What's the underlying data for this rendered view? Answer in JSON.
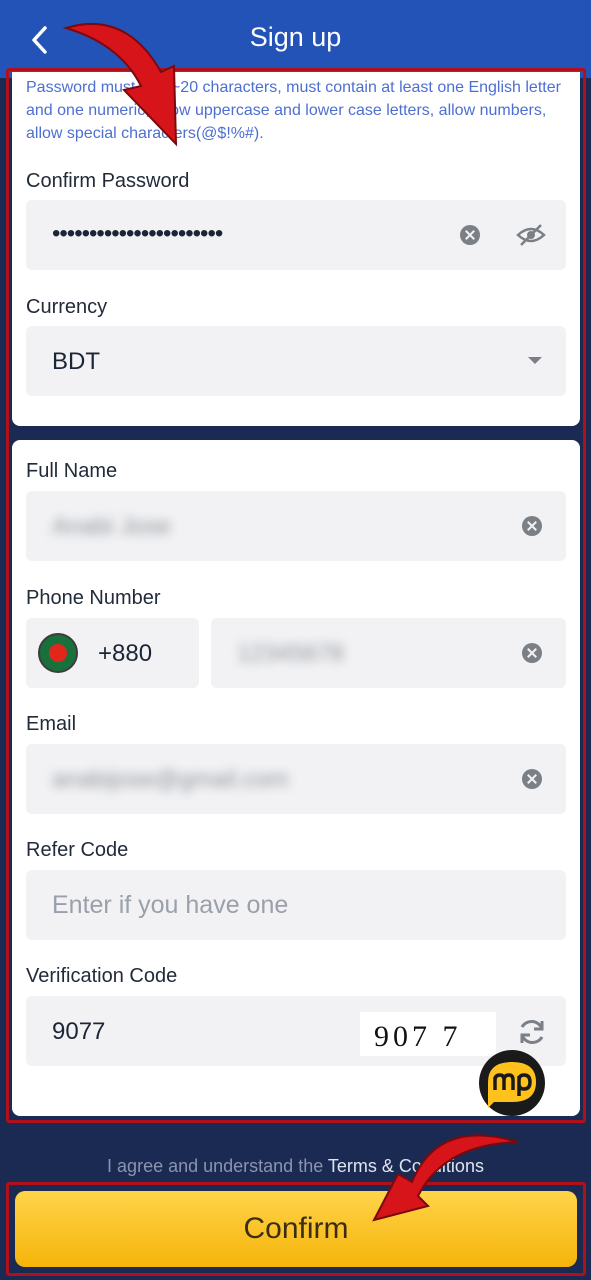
{
  "header": {
    "title": "Sign up",
    "back_icon": "chevron-left-icon"
  },
  "password_hint": "Password must be 6~20 characters, must contain at least one English letter and one numeric, allow uppercase and lower case letters, allow numbers, allow special characters(@$!%#).",
  "confirm_password": {
    "label": "Confirm Password",
    "value": "•••••••••••••••••••••••"
  },
  "currency": {
    "label": "Currency",
    "value": "BDT"
  },
  "full_name": {
    "label": "Full Name",
    "value": "Anabi Jose"
  },
  "phone": {
    "label": "Phone Number",
    "country_code": "+880",
    "value": "12345678"
  },
  "email": {
    "label": "Email",
    "value": "anabijose@gmail.com"
  },
  "refer_code": {
    "label": "Refer Code",
    "placeholder": "Enter if you have one"
  },
  "verification": {
    "label": "Verification Code",
    "value": "9077",
    "captcha_text": "907 7"
  },
  "agree": {
    "prefix": "I agree and understand the ",
    "link": "Terms & Conditions"
  },
  "confirm_label": "Confirm",
  "colors": {
    "header": "#2453b8",
    "background": "#1a2a52",
    "confirm": "#f5b40a",
    "highlight": "#b0101a"
  }
}
